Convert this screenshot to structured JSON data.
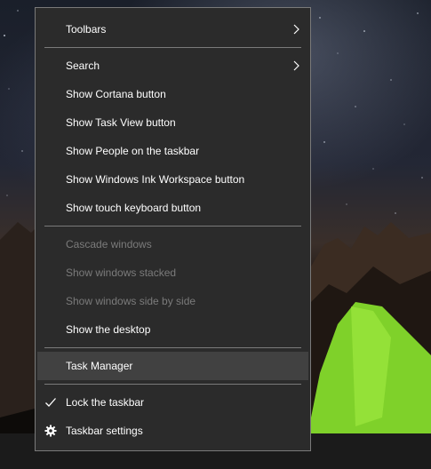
{
  "menu": {
    "items": [
      {
        "label": "Toolbars"
      },
      {
        "label": "Search"
      },
      {
        "label": "Show Cortana button"
      },
      {
        "label": "Show Task View button"
      },
      {
        "label": "Show People on the taskbar"
      },
      {
        "label": "Show Windows Ink Workspace button"
      },
      {
        "label": "Show touch keyboard button"
      },
      {
        "label": "Cascade windows"
      },
      {
        "label": "Show windows stacked"
      },
      {
        "label": "Show windows side by side"
      },
      {
        "label": "Show the desktop"
      },
      {
        "label": "Task Manager"
      },
      {
        "label": "Lock the taskbar"
      },
      {
        "label": "Taskbar settings"
      }
    ]
  },
  "icons": {
    "submenu": "chevron-right-icon",
    "lock_checked": "checkmark-icon",
    "settings": "gear-icon"
  },
  "colors": {
    "menu_background": "#2b2b2b",
    "menu_border": "#7a7a7a",
    "highlight": "#414141",
    "text": "#ffffff",
    "disabled_text": "#7b7b7b",
    "tent_green": "#7fd12a"
  }
}
